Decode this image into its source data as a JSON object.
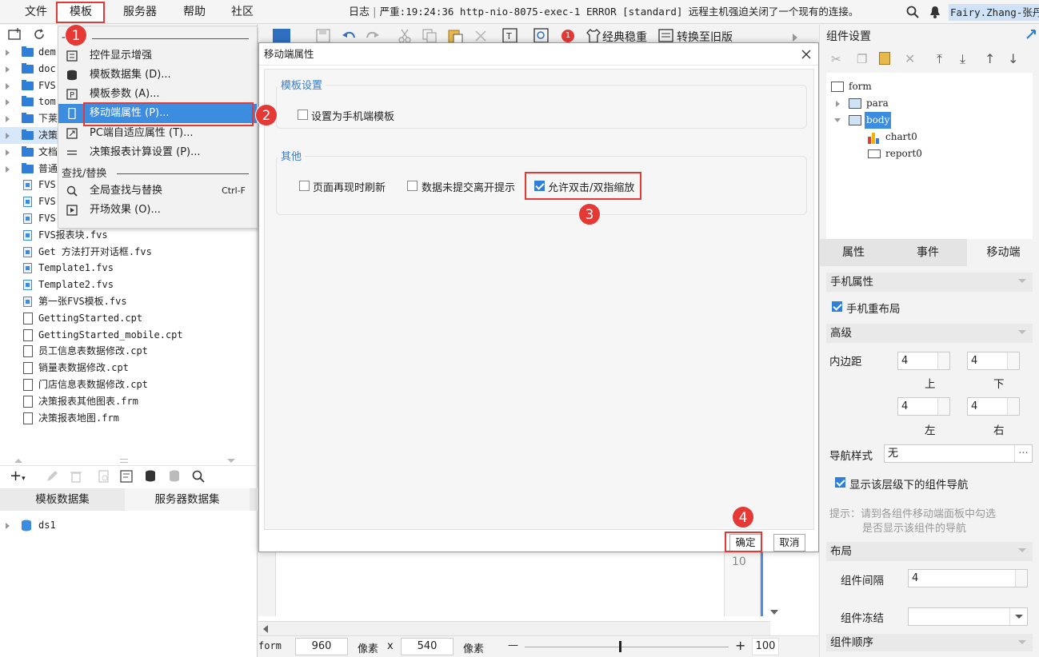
{
  "menubar": {
    "items": [
      "文件",
      "模板",
      "服务器",
      "帮助",
      "社区"
    ],
    "status_prefix": "日志",
    "status_text": "严重:19:24:36 http-nio-8075-exec-1 ERROR [standard] 远程主机强迫关闭了一个现有的连接。",
    "user": "Fairy.Zhang-张丹"
  },
  "badges": [
    "1",
    "2",
    "3",
    "4"
  ],
  "template_menu": {
    "section_label_partial": "一般",
    "items": [
      {
        "label": "控件显示增强",
        "icon": "enhance-icon"
      },
      {
        "label": "模板数据集 (D)...",
        "icon": "database-icon"
      },
      {
        "label": "模板参数 (A)...",
        "icon": "parameter-icon"
      },
      {
        "label": "移动端属性 (P)...",
        "icon": "mobile-icon"
      },
      {
        "label": "PC端自适应属性 (T)...",
        "icon": "adaptive-icon"
      },
      {
        "label": "决策报表计算设置 (P)...",
        "icon": "calc-icon"
      }
    ],
    "section2": "查找/替换",
    "items2": [
      {
        "label": "全局查找与替换",
        "shortcut": "Ctrl-F",
        "icon": "find-replace-icon"
      },
      {
        "label": "开场效果 (O)...",
        "icon": "opening-effect-icon"
      }
    ]
  },
  "file_tree": {
    "folders": [
      "dem",
      "doc",
      "FVS",
      "tom",
      "下莱",
      "决策",
      "文档",
      "普通"
    ],
    "fvs_partial": [
      "FVS",
      "FVS",
      "FVS"
    ],
    "files": [
      {
        "name": "FVS报表块.fvs",
        "type": "fvs"
      },
      {
        "name": "Get 方法打开对话框.fvs",
        "type": "fvs"
      },
      {
        "name": "Template1.fvs",
        "type": "fvs"
      },
      {
        "name": "Template2.fvs",
        "type": "fvs"
      },
      {
        "name": "第一张FVS模板.fvs",
        "type": "fvs"
      },
      {
        "name": "GettingStarted.cpt",
        "type": "doc"
      },
      {
        "name": "GettingStarted_mobile.cpt",
        "type": "doc"
      },
      {
        "name": "员工信息表数据修改.cpt",
        "type": "doc"
      },
      {
        "name": "销量表数据修改.cpt",
        "type": "doc"
      },
      {
        "name": "门店信息表数据修改.cpt",
        "type": "doc"
      },
      {
        "name": "决策报表其他图表.frm",
        "type": "doc"
      },
      {
        "name": "决策报表地图.frm",
        "type": "doc"
      }
    ]
  },
  "dataset_tabs": [
    "模板数据集",
    "服务器数据集"
  ],
  "datasets": [
    "ds1"
  ],
  "toolbar": {
    "classic_label": "经典稳重",
    "convert_label": "转换至旧版"
  },
  "dialog": {
    "title": "移动端属性",
    "group1_title": "模板设置",
    "set_mobile_template": "设置为手机端模板",
    "group2_title": "其他",
    "refresh_on_show": "页面再现时刷新",
    "unsubmitted_prompt": "数据未提交离开提示",
    "allow_double_tap_zoom": "允许双击/双指缩放",
    "ok": "确定",
    "cancel": "取消",
    "canvas_row_number": "10"
  },
  "right_panel": {
    "title": "组件设置",
    "tree": [
      "form",
      "para",
      "body",
      "chart0",
      "report0"
    ],
    "tabs": [
      "属性",
      "事件",
      "移动端"
    ],
    "sec_phone": "手机属性",
    "phone_relayout": "手机重布局",
    "sec_advanced": "高级",
    "padding_label": "内边距",
    "padding": {
      "top": "4",
      "bottom": "4",
      "left": "4",
      "right": "4"
    },
    "padding_dir": {
      "top": "上",
      "bottom": "下",
      "left": "左",
      "right": "右"
    },
    "nav_style_label": "导航样式",
    "nav_style_value": "无",
    "show_nav_label": "显示该层级下的组件导航",
    "hint1": "提示：请到各组件移动端面板中勾选",
    "hint2": "是否显示该组件的导航",
    "sec_layout": "布局",
    "gap_label": "组件间隔",
    "gap_value": "4",
    "freeze_label": "组件冻结",
    "order_label": "组件顺序"
  },
  "bottom_bar": {
    "form_label": "form",
    "width": "960",
    "unit1": "像素",
    "x": "x",
    "height": "540",
    "unit2": "像素",
    "zoom": "100",
    "minus": "—",
    "plus": "+"
  },
  "colors": {
    "accent": "#2f7fd8",
    "highlight": "#e53935",
    "selection": "#3c8ce0"
  }
}
